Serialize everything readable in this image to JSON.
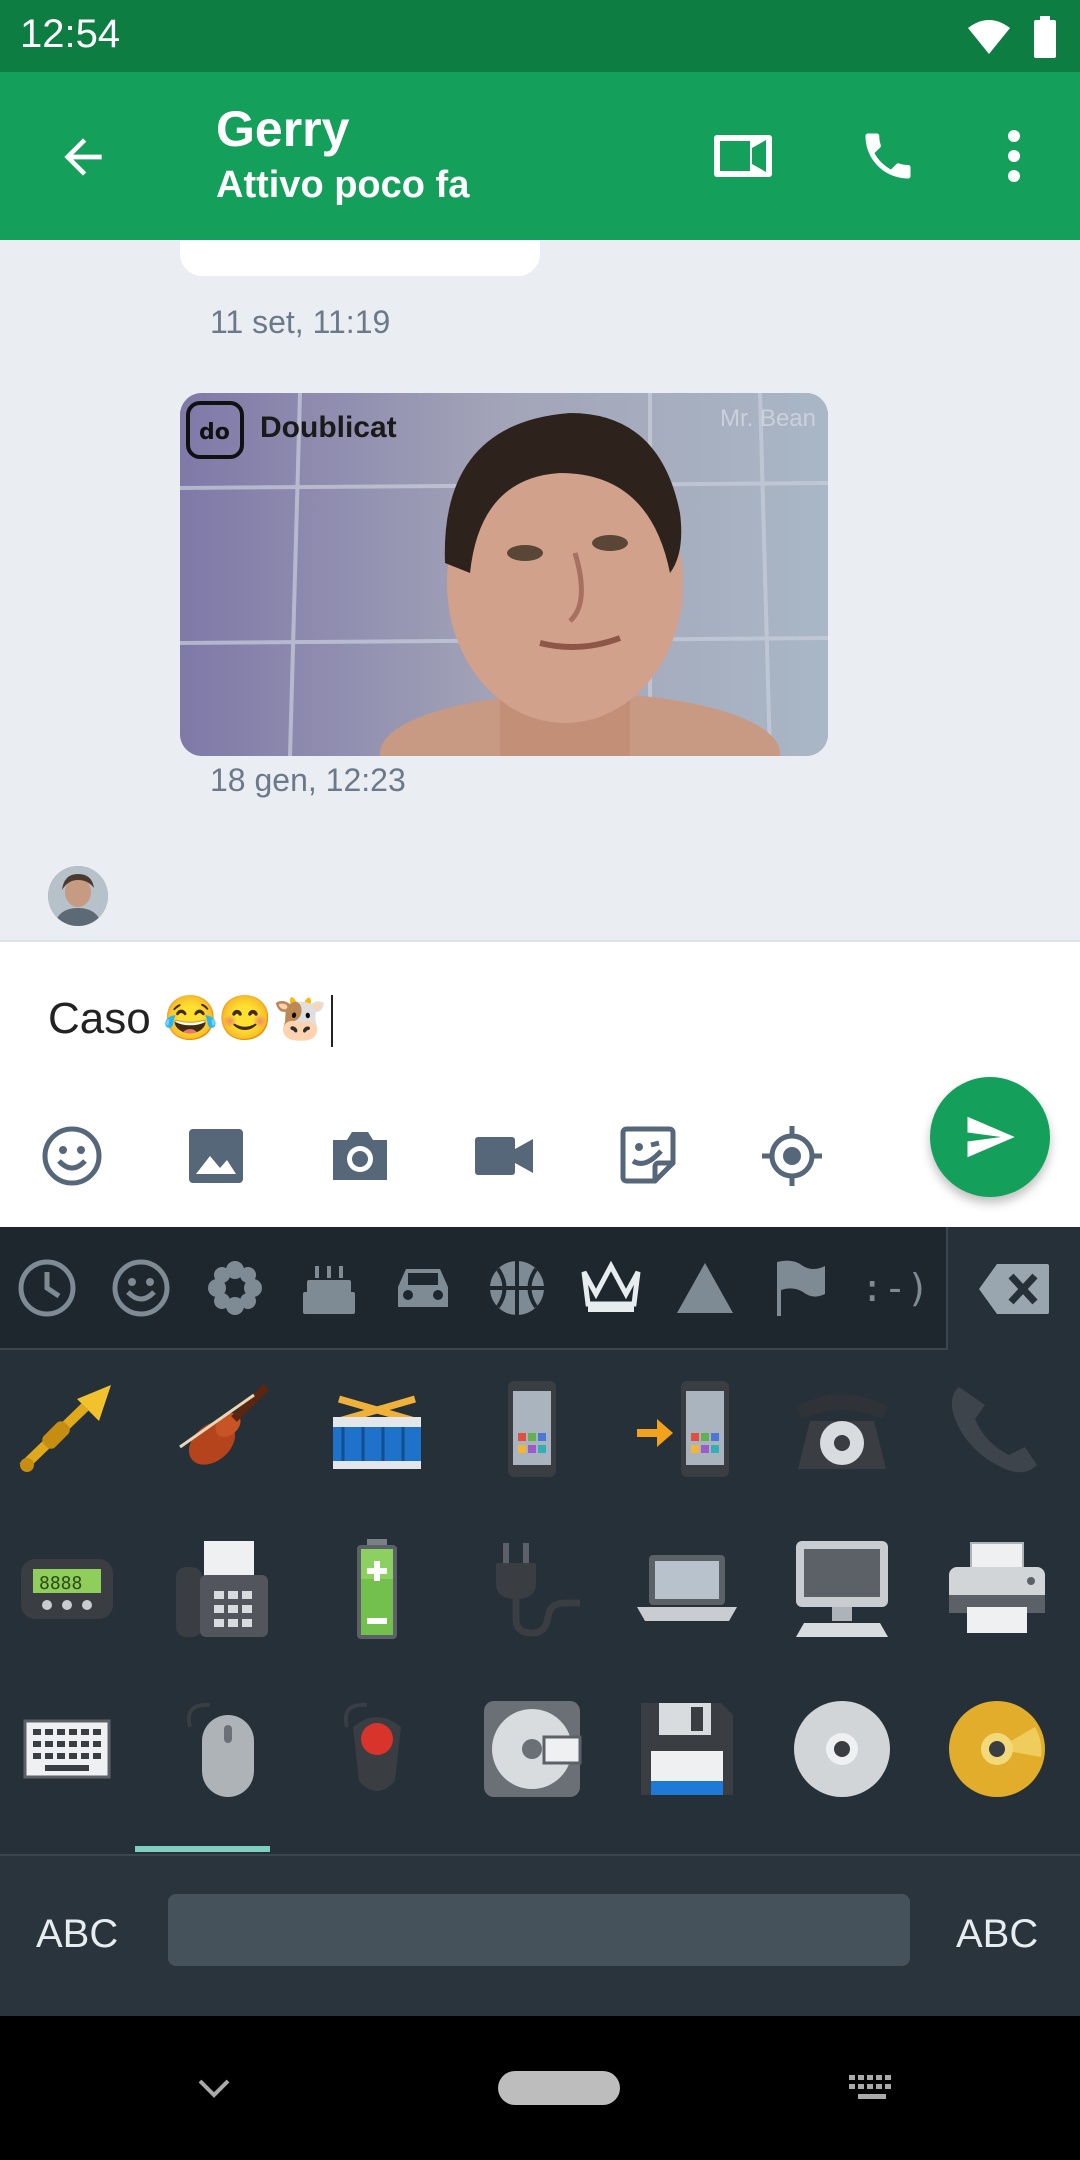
{
  "status_bar": {
    "time": "12:54"
  },
  "header": {
    "name": "Gerry",
    "status": "Attivo poco fa"
  },
  "messages": [
    {
      "time": "11 set, 11:19"
    },
    {
      "type": "gif",
      "watermark_brand": "Doublicat",
      "watermark_source": "Mr. Bean",
      "time": "18 gen, 12:23"
    }
  ],
  "composer": {
    "text": "Caso 😂😊🐮"
  },
  "keyboard": {
    "left_abc": "ABC",
    "right_abc": "ABC",
    "emoticon_tab": ":-)"
  },
  "colors": {
    "primary": "#14a05a",
    "primary_dark": "#0e7d42",
    "keyboard_bg": "#263038",
    "accent_indicator": "#7fcfc0"
  }
}
